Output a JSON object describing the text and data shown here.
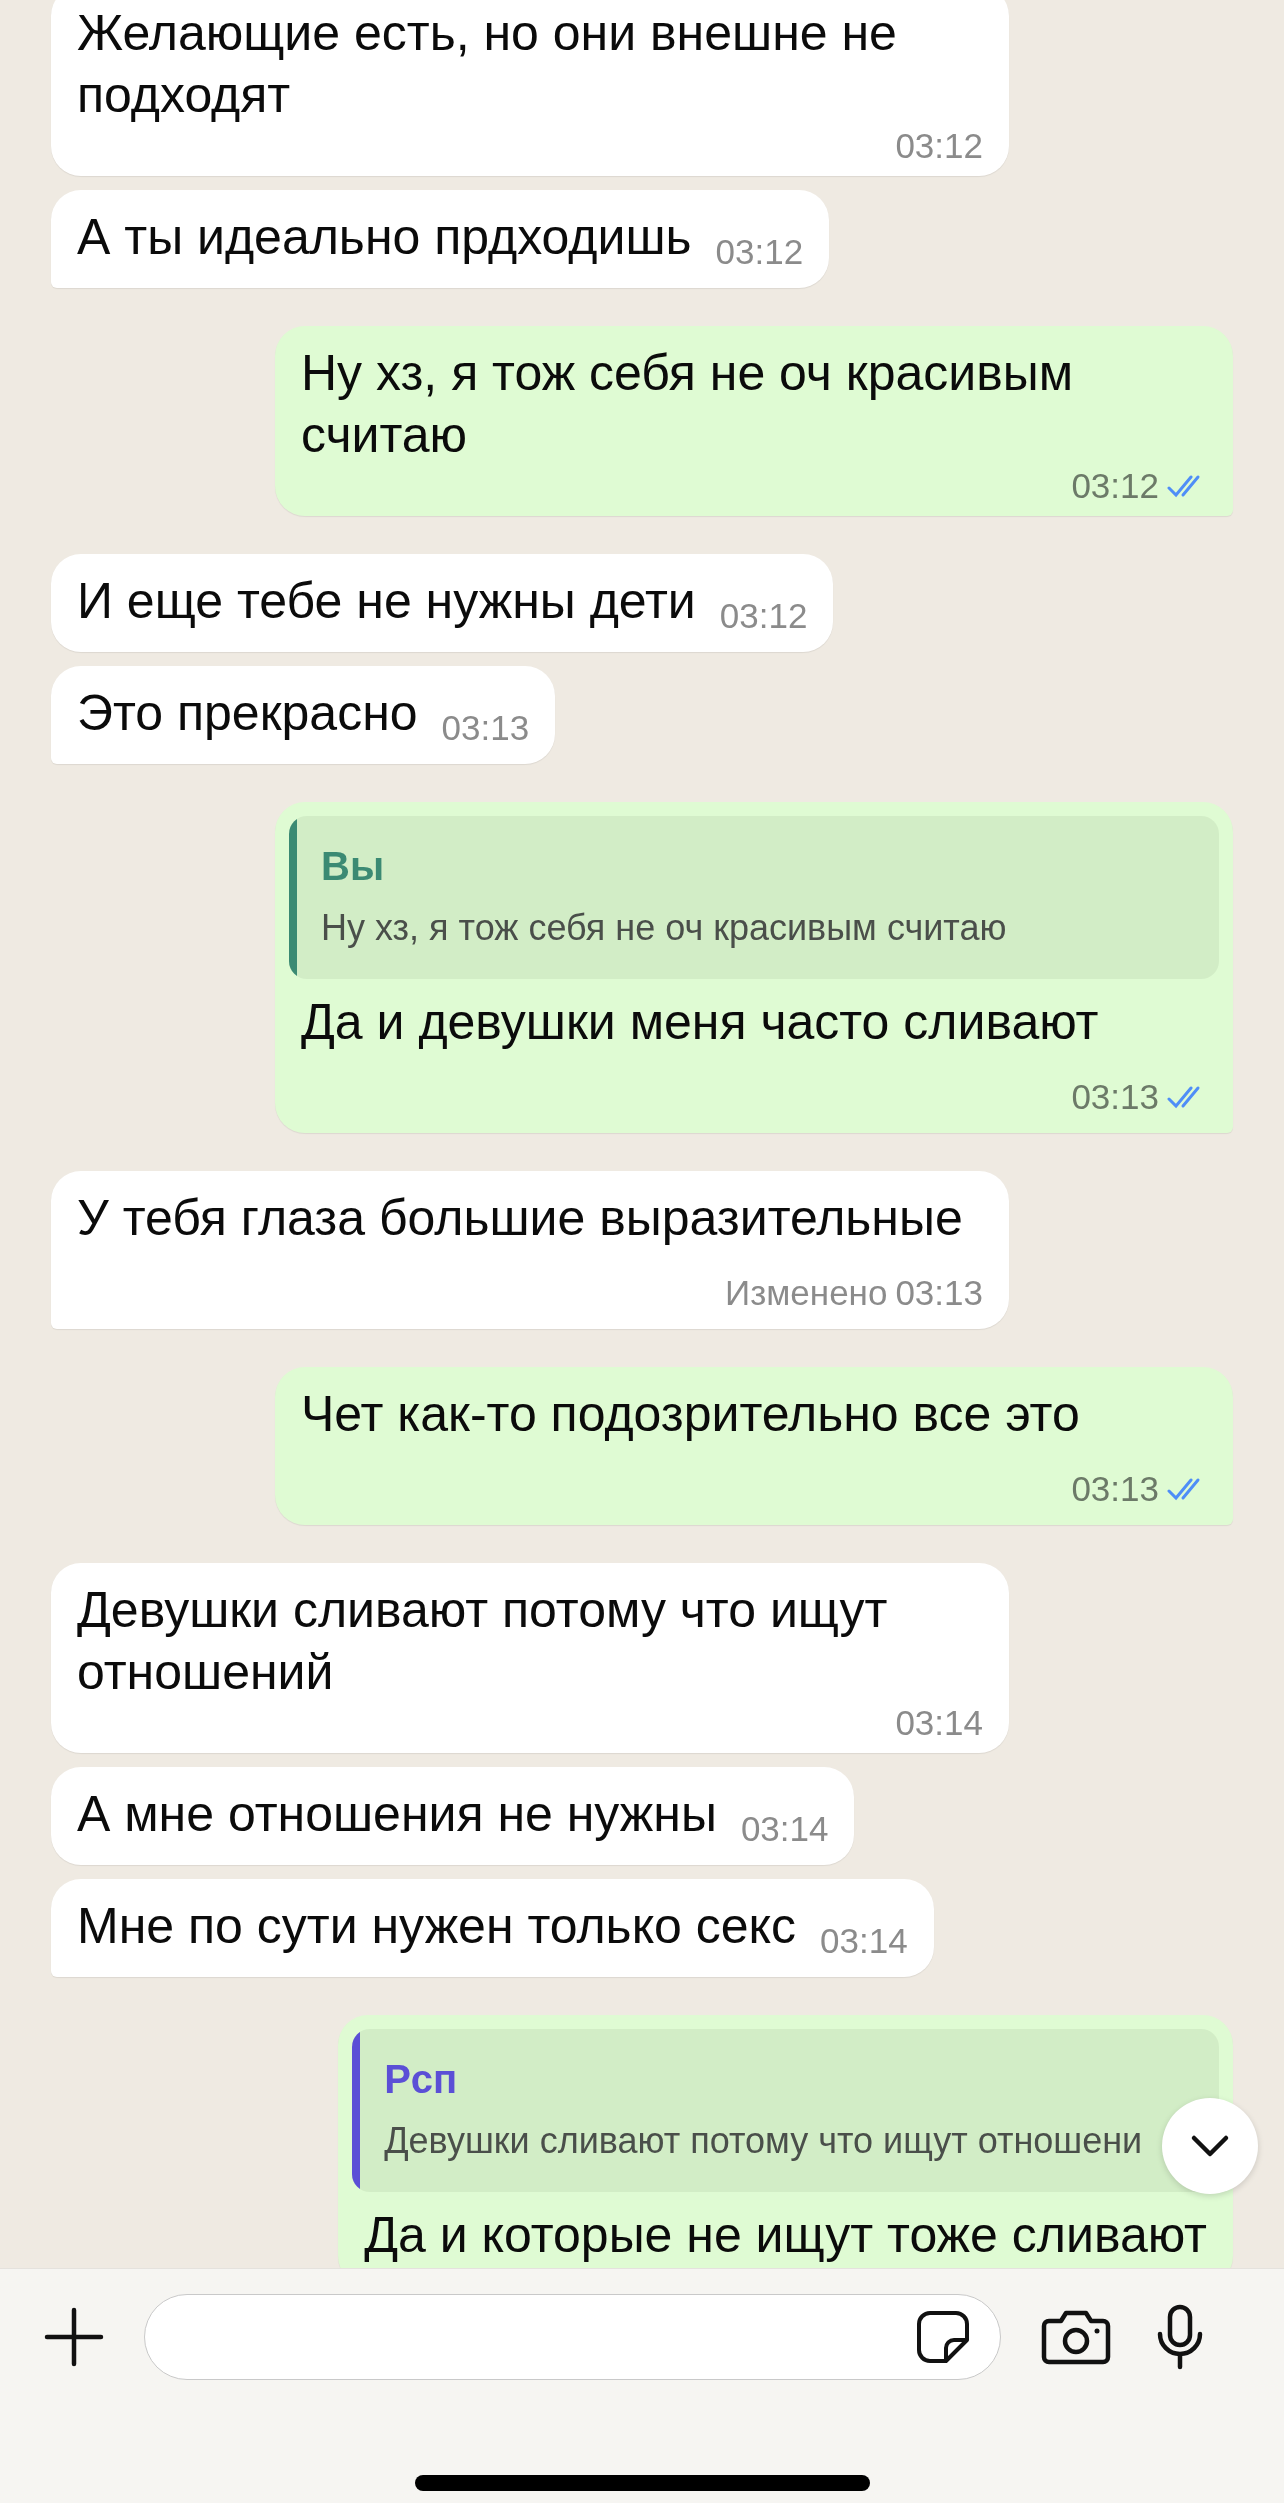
{
  "messages": [
    {
      "kind": "incoming",
      "text": "Желающие есть, но они внешне не подходят",
      "time": "03:12"
    },
    {
      "kind": "incoming",
      "text": "А ты идеально прдходишь",
      "time": "03:12"
    },
    {
      "kind": "outgoing",
      "text": "Ну хз, я тож себя не оч красивым считаю",
      "time": "03:12",
      "read": true
    },
    {
      "kind": "incoming",
      "text": "И еще тебе не нужны дети",
      "time": "03:12"
    },
    {
      "kind": "incoming",
      "text": "Это прекрасно",
      "time": "03:13"
    },
    {
      "kind": "outgoing",
      "reply": {
        "author": "Вы",
        "text": "Ну хз, я тож себя не оч красивым считаю",
        "color": "#3b8a73"
      },
      "text": "Да и девушки меня часто сливают",
      "time": "03:13",
      "read": true
    },
    {
      "kind": "incoming",
      "text": "У тебя глаза большие выразительные",
      "edited_label": "Изменено",
      "time": "03:13"
    },
    {
      "kind": "outgoing",
      "text": "Чет как-то подозрительно все это",
      "time": "03:13",
      "read": true
    },
    {
      "kind": "incoming",
      "text": "Девушки сливают потому что ищут отношений",
      "time": "03:14"
    },
    {
      "kind": "incoming",
      "text": "А мне отношения не нужны",
      "time": "03:14"
    },
    {
      "kind": "incoming",
      "text": "Мне по сути нужен только секс",
      "time": "03:14"
    },
    {
      "kind": "outgoing",
      "reply": {
        "author": "Рсп",
        "text": "Девушки сливают потому что ищут отношени",
        "color": "#5b4fd6"
      },
      "text": "Да и которые не ищут тоже сливают"
    }
  ]
}
